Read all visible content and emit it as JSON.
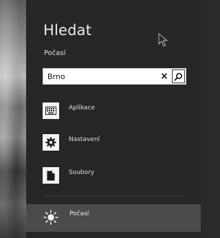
{
  "charm": {
    "title": "Hledat",
    "scope_label": "Počasí"
  },
  "search": {
    "value": "Brno",
    "clear_icon": "×"
  },
  "filters": [
    {
      "label": "Aplikace",
      "icon": "keyboard-icon"
    },
    {
      "label": "Nastavení",
      "icon": "gear-icon"
    },
    {
      "label": "Soubory",
      "icon": "document-icon"
    }
  ],
  "suggestion": {
    "label": "Počasí",
    "icon": "sun-icon"
  },
  "colors": {
    "panel": "#262626",
    "suggestion_bg": "#4b4b4b",
    "text": "#e4e4e4"
  }
}
